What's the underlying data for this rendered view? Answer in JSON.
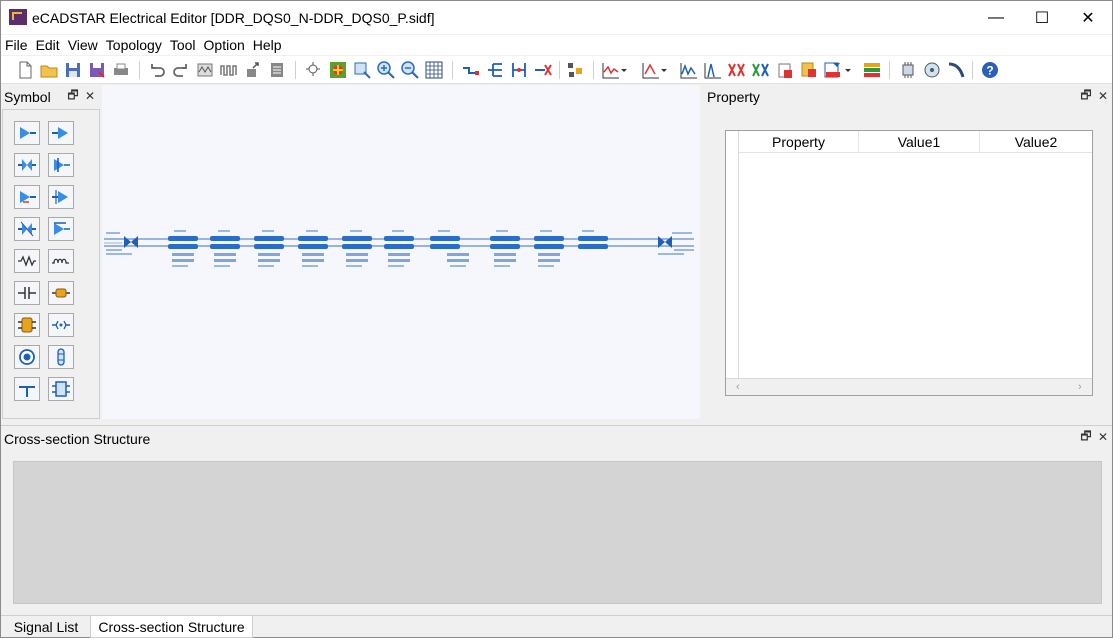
{
  "window": {
    "title": "eCADSTAR Electrical Editor [DDR_DQS0_N-DDR_DQS0_P.sidf]",
    "minimize_glyph": "—",
    "maximize_glyph": "☐",
    "close_glyph": "✕"
  },
  "menu": {
    "items": [
      "File",
      "Edit",
      "View",
      "Topology",
      "Tool",
      "Option",
      "Help"
    ]
  },
  "toolbar": {
    "icons": [
      "new-icon",
      "open-icon",
      "save-icon",
      "save-as-icon",
      "print-icon",
      "undo-icon",
      "redo-icon",
      "wave-icon",
      "pulse-icon",
      "export-icon",
      "report-icon",
      "fit-icon",
      "select-area-icon",
      "zoom-window-icon",
      "zoom-in-icon",
      "zoom-out-icon",
      "grid-icon",
      "net-icon",
      "tree-icon",
      "hierarchy-icon",
      "delete-net-icon",
      "component-icon",
      "waveform-icon",
      "eye-icon",
      "spectrum-icon",
      "impulse-icon",
      "crosstalk-icon",
      "coupling-icon",
      "export-report-icon",
      "pdf-icon",
      "spice-icon",
      "layer-icon",
      "chip-icon",
      "disk-icon",
      "cable-icon",
      "help-icon"
    ]
  },
  "symbol_panel": {
    "title": "Symbol",
    "float_glyph": "🗗",
    "close_glyph": "✕",
    "items": [
      "driver-icon",
      "receiver-icon",
      "transceiver-icon",
      "driver-receiver-icon",
      "bidir-driver-icon",
      "bidir-receiver-icon",
      "crossed-buffer-icon",
      "buffer-enable-icon",
      "resistor-icon",
      "inductor-icon",
      "capacitor-icon",
      "fuse-icon",
      "connector-icon",
      "switch-icon",
      "via-icon",
      "pin-icon",
      "ground-icon",
      "package-icon"
    ]
  },
  "property_panel": {
    "title": "Property",
    "float_glyph": "🗗",
    "close_glyph": "✕",
    "columns": [
      "Property",
      "Value1",
      "Value2"
    ],
    "scroll_left": "‹",
    "scroll_right": "›"
  },
  "cross_section": {
    "title": "Cross-section Structure",
    "float_glyph": "🗗",
    "close_glyph": "✕"
  },
  "tabs": {
    "items": [
      "Signal List",
      "Cross-section Structure"
    ],
    "active": "Cross-section Structure"
  },
  "colors": {
    "accent_blue": "#1f5fb5",
    "canvas_bg": "#f5f7fc",
    "cs_bg": "#d4d4d4"
  }
}
